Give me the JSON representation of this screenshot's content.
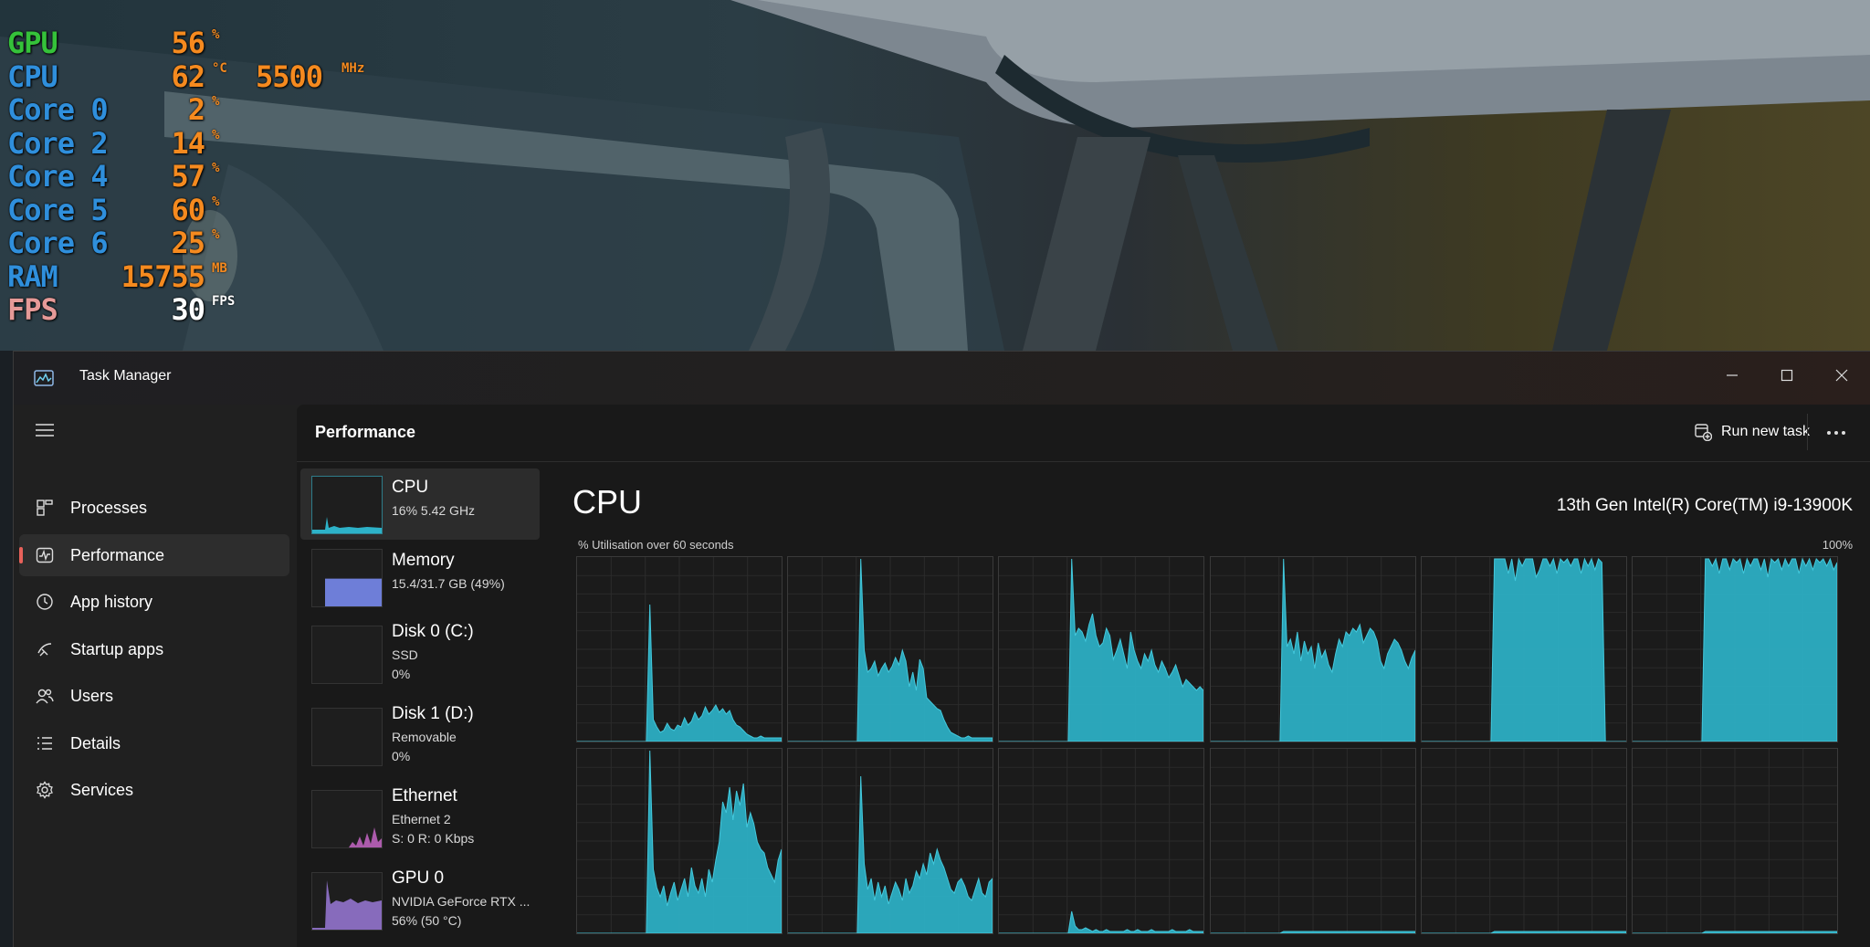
{
  "colors": {
    "hud_gpu_label": "#35c23a",
    "hud_cpu_label": "#2f8fdc",
    "hud_core_label": "#2f8fdc",
    "hud_ram_label": "#2f8fdc",
    "hud_fps_label": "#e69a98",
    "hud_value": "#f58a1f",
    "hud_fps_value": "#ffffff",
    "graph_fill": "#2db2c8",
    "graph_stroke": "#43c8dc",
    "accent": "#e8615a",
    "memory_fill": "#6e7ed8",
    "ethernet_fill": "#d06ad0",
    "gpu_fill": "#9a79d8"
  },
  "hud": {
    "rows": [
      {
        "label": "GPU",
        "value": "56",
        "unit": "%"
      },
      {
        "label": "CPU",
        "value": "62",
        "unit": "°C",
        "value2": "5500",
        "unit2": "MHz"
      },
      {
        "label": "Core 0",
        "value": "2",
        "unit": "%"
      },
      {
        "label": "Core 2",
        "value": "14",
        "unit": "%"
      },
      {
        "label": "Core 4",
        "value": "57",
        "unit": "%"
      },
      {
        "label": "Core 5",
        "value": "60",
        "unit": "%"
      },
      {
        "label": "Core 6",
        "value": "25",
        "unit": "%"
      },
      {
        "label": "RAM",
        "value": "15755",
        "unit": "MB"
      },
      {
        "label": "FPS",
        "value": "30",
        "unit": "FPS"
      }
    ]
  },
  "window": {
    "title": "Task Manager",
    "minimize_icon": "minimize-icon",
    "maximize_icon": "maximize-icon",
    "close_icon": "close-icon"
  },
  "sidebar": {
    "items": [
      {
        "label": "Processes",
        "icon": "processes-icon"
      },
      {
        "label": "Performance",
        "icon": "performance-icon",
        "active": true
      },
      {
        "label": "App history",
        "icon": "history-icon"
      },
      {
        "label": "Startup apps",
        "icon": "startup-icon"
      },
      {
        "label": "Users",
        "icon": "users-icon"
      },
      {
        "label": "Details",
        "icon": "details-icon"
      },
      {
        "label": "Services",
        "icon": "services-icon"
      }
    ]
  },
  "header": {
    "title": "Performance",
    "run_new_task": "Run new task",
    "more": "···"
  },
  "resources": {
    "cpu": {
      "name": "CPU",
      "line1": "16%  5.42 GHz"
    },
    "memory": {
      "name": "Memory",
      "line1": "15.4/31.7 GB (49%)",
      "level": 0.49
    },
    "disk0": {
      "name": "Disk 0 (C:)",
      "line1": "SSD",
      "line2": "0%"
    },
    "disk1": {
      "name": "Disk 1 (D:)",
      "line1": "Removable",
      "line2": "0%"
    },
    "ethernet": {
      "name": "Ethernet",
      "line1": "Ethernet 2",
      "line2": "S: 0  R: 0 Kbps"
    },
    "gpu": {
      "name": "GPU 0",
      "line1": "NVIDIA GeForce RTX ...",
      "line2": "56% (50 °C)"
    }
  },
  "cpu_panel": {
    "title": "CPU",
    "model": "13th Gen Intel(R) Core(TM) i9-13900K",
    "subtitle": "% Utilisation over 60 seconds",
    "max_label": "100%"
  },
  "chart_data": {
    "type": "area",
    "x_axis": "% Utilisation over 60 seconds",
    "ylim": [
      0,
      100
    ],
    "series": [
      {
        "values": [
          0,
          0,
          0,
          0,
          0,
          0,
          0,
          0,
          0,
          0,
          0,
          0,
          0,
          0,
          0,
          0,
          0,
          0,
          0,
          0,
          0,
          75,
          12,
          8,
          5,
          6,
          10,
          7,
          6,
          9,
          8,
          13,
          9,
          11,
          16,
          12,
          14,
          19,
          15,
          17,
          20,
          16,
          18,
          15,
          17,
          12,
          9,
          8,
          6,
          4,
          3,
          2,
          2,
          3,
          2,
          2,
          2,
          2,
          2,
          2
        ]
      },
      {
        "values": [
          0,
          0,
          0,
          0,
          0,
          0,
          0,
          0,
          0,
          0,
          0,
          0,
          0,
          0,
          0,
          0,
          0,
          0,
          0,
          0,
          0,
          100,
          50,
          38,
          40,
          44,
          36,
          40,
          43,
          38,
          41,
          46,
          42,
          50,
          44,
          30,
          38,
          28,
          45,
          40,
          24,
          22,
          20,
          18,
          17,
          12,
          8,
          5,
          4,
          3,
          2,
          2,
          3,
          2,
          2,
          2,
          2,
          2,
          2,
          2
        ]
      },
      {
        "values": [
          0,
          0,
          0,
          0,
          0,
          0,
          0,
          0,
          0,
          0,
          0,
          0,
          0,
          0,
          0,
          0,
          0,
          0,
          0,
          0,
          0,
          100,
          58,
          62,
          60,
          55,
          64,
          70,
          58,
          52,
          54,
          62,
          58,
          45,
          50,
          56,
          48,
          40,
          60,
          50,
          44,
          40,
          48,
          44,
          50,
          42,
          38,
          44,
          40,
          35,
          38,
          42,
          36,
          30,
          34,
          32,
          30,
          28,
          30,
          28
        ]
      },
      {
        "values": [
          0,
          0,
          0,
          0,
          0,
          0,
          0,
          0,
          0,
          0,
          0,
          0,
          0,
          0,
          0,
          0,
          0,
          0,
          0,
          0,
          0,
          100,
          52,
          56,
          48,
          60,
          44,
          55,
          48,
          52,
          40,
          54,
          46,
          50,
          42,
          38,
          48,
          56,
          52,
          60,
          58,
          62,
          60,
          64,
          54,
          58,
          62,
          60,
          55,
          44,
          40,
          48,
          52,
          56,
          54,
          50,
          44,
          40,
          46,
          50
        ]
      },
      {
        "values": [
          0,
          0,
          0,
          0,
          0,
          0,
          0,
          0,
          0,
          0,
          0,
          0,
          0,
          0,
          0,
          0,
          0,
          0,
          0,
          0,
          0,
          100,
          100,
          100,
          100,
          92,
          100,
          88,
          100,
          96,
          100,
          100,
          100,
          90,
          94,
          100,
          100,
          96,
          100,
          92,
          100,
          98,
          100,
          96,
          100,
          100,
          92,
          100,
          96,
          100,
          94,
          100,
          98,
          0,
          0,
          0,
          0,
          0,
          0,
          0
        ]
      },
      {
        "values": [
          0,
          0,
          0,
          0,
          0,
          0,
          0,
          0,
          0,
          0,
          0,
          0,
          0,
          0,
          0,
          0,
          0,
          0,
          0,
          0,
          0,
          100,
          100,
          96,
          100,
          92,
          100,
          100,
          94,
          100,
          98,
          100,
          92,
          100,
          96,
          100,
          100,
          94,
          100,
          90,
          100,
          98,
          100,
          94,
          100,
          96,
          100,
          100,
          92,
          100,
          96,
          100,
          94,
          100,
          98,
          100,
          96,
          100,
          94,
          98
        ]
      },
      {
        "values": [
          0,
          0,
          0,
          0,
          0,
          0,
          0,
          0,
          0,
          0,
          0,
          0,
          0,
          0,
          0,
          0,
          0,
          0,
          0,
          0,
          0,
          100,
          35,
          25,
          20,
          26,
          15,
          22,
          28,
          18,
          24,
          30,
          20,
          36,
          26,
          22,
          30,
          20,
          35,
          28,
          40,
          50,
          72,
          66,
          80,
          62,
          78,
          70,
          82,
          58,
          66,
          60,
          50,
          46,
          44,
          36,
          32,
          28,
          40,
          46
        ]
      },
      {
        "values": [
          0,
          0,
          0,
          0,
          0,
          0,
          0,
          0,
          0,
          0,
          0,
          0,
          0,
          0,
          0,
          0,
          0,
          0,
          0,
          0,
          0,
          86,
          38,
          24,
          30,
          18,
          28,
          20,
          26,
          16,
          22,
          28,
          24,
          18,
          30,
          22,
          26,
          34,
          30,
          38,
          32,
          44,
          38,
          46,
          40,
          36,
          30,
          24,
          22,
          28,
          30,
          26,
          20,
          18,
          24,
          30,
          22,
          20,
          28,
          30
        ]
      },
      {
        "values": [
          0,
          0,
          0,
          0,
          0,
          0,
          0,
          0,
          0,
          0,
          0,
          0,
          0,
          0,
          0,
          0,
          0,
          0,
          0,
          0,
          0,
          12,
          4,
          2,
          2,
          3,
          2,
          1,
          2,
          1,
          1,
          2,
          1,
          1,
          1,
          1,
          1,
          2,
          1,
          1,
          2,
          1,
          1,
          1,
          2,
          1,
          1,
          1,
          1,
          1,
          2,
          1,
          1,
          1,
          1,
          2,
          1,
          1,
          1,
          1
        ]
      },
      {
        "values": [
          0,
          0,
          0,
          0,
          0,
          0,
          0,
          0,
          0,
          0,
          0,
          0,
          0,
          0,
          0,
          0,
          0,
          0,
          0,
          0,
          0,
          1,
          1,
          1,
          1,
          1,
          1,
          1,
          1,
          1,
          1,
          1,
          1,
          1,
          1,
          1,
          1,
          1,
          1,
          1,
          1,
          1,
          1,
          1,
          1,
          1,
          1,
          1,
          1,
          1,
          1,
          1,
          1,
          1,
          1,
          1,
          1,
          1,
          1,
          1
        ]
      },
      {
        "values": [
          0,
          0,
          0,
          0,
          0,
          0,
          0,
          0,
          0,
          0,
          0,
          0,
          0,
          0,
          0,
          0,
          0,
          0,
          0,
          0,
          0,
          1,
          1,
          1,
          1,
          1,
          1,
          1,
          1,
          1,
          1,
          1,
          1,
          1,
          1,
          1,
          1,
          1,
          1,
          1,
          1,
          1,
          1,
          1,
          1,
          1,
          1,
          1,
          1,
          1,
          1,
          1,
          1,
          1,
          1,
          1,
          1,
          1,
          1,
          1
        ]
      },
      {
        "values": [
          0,
          0,
          0,
          0,
          0,
          0,
          0,
          0,
          0,
          0,
          0,
          0,
          0,
          0,
          0,
          0,
          0,
          0,
          0,
          0,
          0,
          1,
          1,
          1,
          1,
          1,
          1,
          1,
          1,
          1,
          1,
          1,
          1,
          1,
          1,
          1,
          1,
          1,
          1,
          1,
          1,
          1,
          1,
          1,
          1,
          1,
          1,
          1,
          1,
          1,
          1,
          1,
          1,
          1,
          1,
          1,
          1,
          1,
          1,
          1
        ]
      }
    ]
  }
}
